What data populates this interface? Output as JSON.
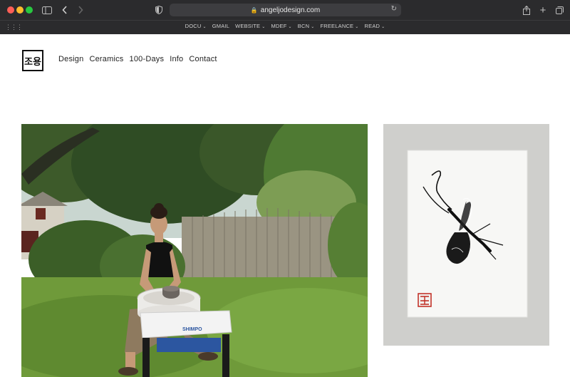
{
  "browser": {
    "url": "angeljodesign.com",
    "favorites": [
      {
        "label": "DOCU",
        "dropdown": true
      },
      {
        "label": "GMAIL",
        "dropdown": false
      },
      {
        "label": "WEBSITE",
        "dropdown": true
      },
      {
        "label": "MDEF",
        "dropdown": true
      },
      {
        "label": "BCN",
        "dropdown": true
      },
      {
        "label": "FREELANCE",
        "dropdown": true
      },
      {
        "label": "READ",
        "dropdown": true
      }
    ]
  },
  "site": {
    "logo_text": "조용",
    "nav": [
      "Design",
      "Ceramics",
      "100-Days",
      "Info",
      "Contact"
    ]
  },
  "gallery": {
    "images": [
      {
        "name": "pottery-photo",
        "wheel_brand": "SHIMPO"
      },
      {
        "name": "ink-print-photo",
        "subject": "insect ink drawing with red seal"
      }
    ]
  },
  "colors": {
    "chrome": "#2b2b2d",
    "close": "#fe5f57",
    "minimize": "#febc2e",
    "zoom": "#28c840"
  }
}
